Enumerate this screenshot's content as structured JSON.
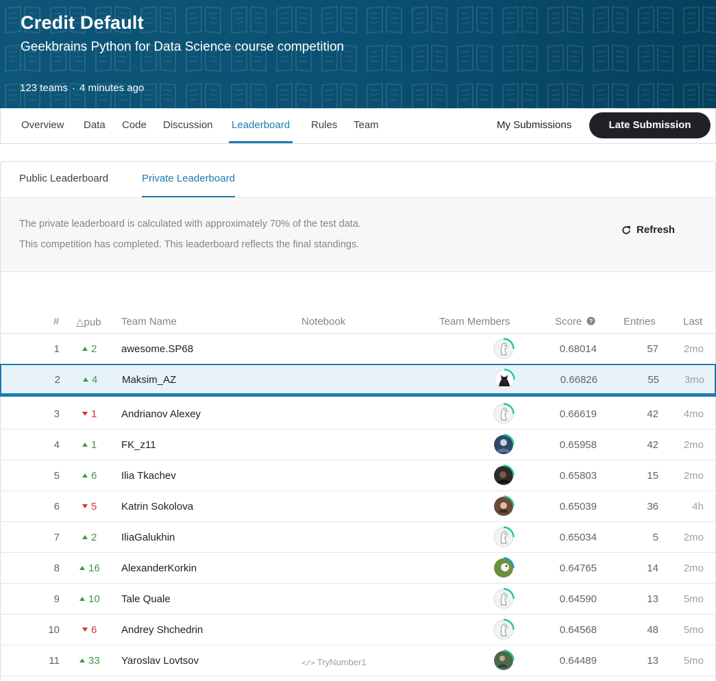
{
  "header": {
    "title": "Credit Default",
    "subtitle": "Geekbrains Python for Data Science course competition",
    "teams": "123 teams",
    "separator": "·",
    "updated": "4 minutes ago",
    "bg_color": "#0b5477"
  },
  "nav": {
    "tabs": [
      "Overview",
      "Data",
      "Code",
      "Discussion",
      "Leaderboard",
      "Rules",
      "Team"
    ],
    "active_tab": "Leaderboard",
    "my_submissions": "My Submissions",
    "late_submission": "Late Submission"
  },
  "leaderboard_tabs": {
    "public": "Public Leaderboard",
    "private": "Private Leaderboard",
    "active": "Private Leaderboard"
  },
  "info": {
    "line1": "The private leaderboard is calculated with approximately 70% of the test data.",
    "line2": "This competition has completed. This leaderboard reflects the final standings.",
    "refresh": "Refresh"
  },
  "table": {
    "headers": {
      "rank": "#",
      "delta": "△pub",
      "team": "Team Name",
      "notebook": "Notebook",
      "members": "Team Members",
      "score": "Score",
      "entries": "Entries",
      "last": "Last"
    },
    "rows": [
      {
        "rank": "1",
        "dir": "up",
        "delta": "2",
        "team": "awesome.SP68",
        "notebook": "",
        "avatar": "default",
        "score": "0.68014",
        "entries": "57",
        "last": "2mo",
        "highlight": false
      },
      {
        "rank": "2",
        "dir": "up",
        "delta": "4",
        "team": "Maksim_AZ",
        "notebook": "",
        "avatar": "batman",
        "score": "0.66826",
        "entries": "55",
        "last": "3mo",
        "highlight": true
      },
      {
        "rank": "3",
        "dir": "down",
        "delta": "1",
        "team": "Andrianov Alexey",
        "notebook": "",
        "avatar": "default",
        "score": "0.66619",
        "entries": "42",
        "last": "4mo",
        "highlight": false
      },
      {
        "rank": "4",
        "dir": "up",
        "delta": "1",
        "team": "FK_z11",
        "notebook": "",
        "avatar": "photo-blue",
        "score": "0.65958",
        "entries": "42",
        "last": "2mo",
        "highlight": false
      },
      {
        "rank": "5",
        "dir": "up",
        "delta": "6",
        "team": "Ilia Tkachev",
        "notebook": "",
        "avatar": "photo-dark",
        "score": "0.65803",
        "entries": "15",
        "last": "2mo",
        "highlight": false
      },
      {
        "rank": "6",
        "dir": "down",
        "delta": "5",
        "team": "Katrin Sokolova",
        "notebook": "",
        "avatar": "photo-woman",
        "score": "0.65039",
        "entries": "36",
        "last": "4h",
        "highlight": false
      },
      {
        "rank": "7",
        "dir": "up",
        "delta": "2",
        "team": "IliaGalukhin",
        "notebook": "",
        "avatar": "default",
        "score": "0.65034",
        "entries": "5",
        "last": "2mo",
        "highlight": false
      },
      {
        "rank": "8",
        "dir": "up",
        "delta": "16",
        "team": "AlexanderKorkin",
        "notebook": "",
        "avatar": "photo-bird",
        "score": "0.64765",
        "entries": "14",
        "last": "2mo",
        "highlight": false
      },
      {
        "rank": "9",
        "dir": "up",
        "delta": "10",
        "team": "Tale Quale",
        "notebook": "",
        "avatar": "default",
        "score": "0.64590",
        "entries": "13",
        "last": "5mo",
        "highlight": false
      },
      {
        "rank": "10",
        "dir": "down",
        "delta": "6",
        "team": "Andrey Shchedrin",
        "notebook": "",
        "avatar": "default",
        "score": "0.64568",
        "entries": "48",
        "last": "5mo",
        "highlight": false
      },
      {
        "rank": "11",
        "dir": "up",
        "delta": "33",
        "team": "Yaroslav Lovtsov",
        "notebook": "TryNumber1",
        "avatar": "photo-outdoor",
        "score": "0.64489",
        "entries": "13",
        "last": "5mo",
        "highlight": false
      }
    ]
  },
  "colors": {
    "accent": "#1e7bb0",
    "up": "#3c9a3c",
    "down": "#d93025",
    "ring": "#20c997"
  }
}
